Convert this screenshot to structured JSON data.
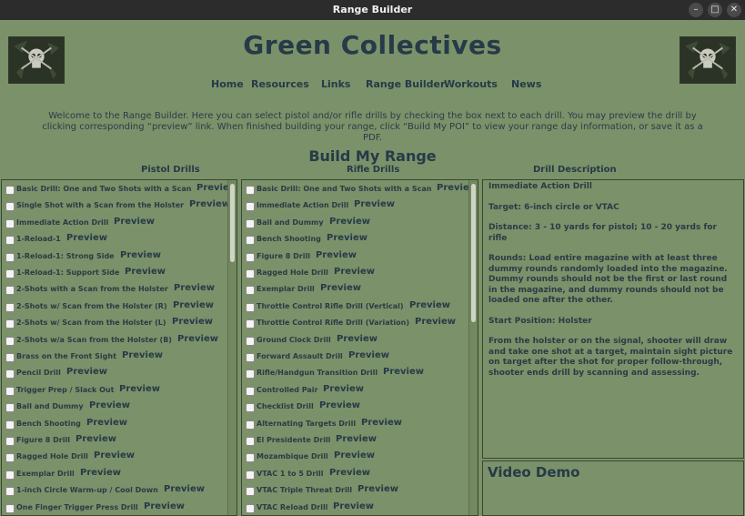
{
  "window": {
    "title": "Range Builder",
    "minimize_glyph": "–",
    "maximize_glyph": "□",
    "close_glyph": "✕"
  },
  "site": {
    "title": "Green Collectives"
  },
  "nav": [
    "Home",
    "Resources",
    "Links",
    "Range Builder",
    "Workouts",
    "News"
  ],
  "welcome": "Welcome to the Range Builder. Here you can select pistol and/or rifle drills by checking the box next to each drill. You may preview the drill by clicking corresponding “preview” link. When finished building your range, click “Build My POI” to view your range day information, or save it as a PDF.",
  "build_title": "Build My Range",
  "columns": {
    "pistol": "Pistol Drills",
    "rifle": "Rifle Drills",
    "description": "Drill Description"
  },
  "preview_label": "Preview",
  "pistol_drills": [
    "Basic Drill: One and Two Shots with a Scan",
    "Single Shot with a Scan from the Holster",
    "Immediate Action Drill",
    "1-Reload-1",
    "1-Reload-1: Strong Side",
    "1-Reload-1: Support Side",
    "2-Shots with a Scan from the Holster",
    "2-Shots w/ Scan from the Holster (R)",
    "2-Shots w/ Scan from the Holster (L)",
    "2-Shots w/a Scan from the Holster (B)",
    "Brass on the Front Sight",
    "Pencil Drill",
    "Trigger Prep / Slack Out",
    "Ball and Dummy",
    "Bench Shooting",
    "Figure 8 Drill",
    "Ragged Hole Drill",
    "Exemplar Drill",
    "1-inch Circle Warm-up / Cool Down",
    "One Finger Trigger Press Drill"
  ],
  "rifle_drills": [
    "Basic Drill: One and Two Shots with a Scan",
    "Immediate Action Drill",
    "Ball and Dummy",
    "Bench Shooting",
    "Figure 8 Drill",
    "Ragged Hole Drill",
    "Exemplar Drill",
    "Throttle Control Rifle Drill (Vertical)",
    "Throttle Control Rifle Drill (Variation)",
    "Ground Clock Drill",
    "Forward Assault Drill",
    "Rifle/Handgun Transition Drill",
    "Controlled Pair",
    "Checklist Drill",
    "Alternating Targets Drill",
    "El Presidente Drill",
    "Mozambique Drill",
    "VTAC 1 to 5 Drill",
    "VTAC Triple Threat Drill",
    "VTAC Reload Drill"
  ],
  "description": [
    "Immediate Action Drill",
    "Target: 6-inch circle or VTAC",
    "Distance: 3 - 10 yards for pistol; 10 - 20 yards for rifle",
    "Rounds: Load entire magazine with at least three dummy rounds randomly loaded into the magazine. Dummy rounds should not be the first or last round in the magazine, and dummy rounds should not be loaded one after the other.",
    "Start Position: Holster",
    "From the holster or on the signal, shooter will draw and take one shot at a target, maintain sight picture on target after the shot for proper follow-through, shooter ends drill by scanning and assessing."
  ],
  "video": {
    "title": "Video Demo"
  },
  "icons": {
    "logo": "tactical-skull-logo-icon",
    "checkbox": "checkbox-icon"
  },
  "colors": {
    "background": "#7b9169",
    "text": "#263a48",
    "titlebar": "#2c2c2c"
  }
}
